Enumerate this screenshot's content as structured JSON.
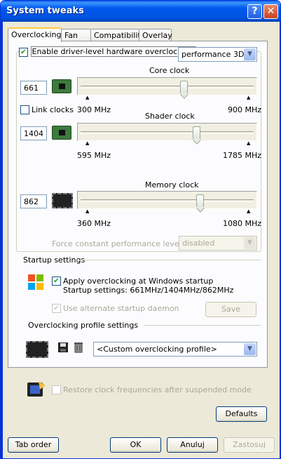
{
  "window": {
    "title": "System tweaks",
    "help_glyph": "?",
    "close_glyph": "✕"
  },
  "tabs": [
    {
      "label": "Overclocking"
    },
    {
      "label": "Fan"
    },
    {
      "label": "Compatibility"
    },
    {
      "label": "Overlay"
    }
  ],
  "overclock": {
    "enable_label": "Enable driver-level hardware overclocking",
    "enable_checked": true,
    "mode_value": "performance 3D",
    "link_clocks_label": "Link clocks",
    "link_clocks_checked": false,
    "core": {
      "title": "Core clock",
      "value": "661",
      "min": "300 MHz",
      "max": "900 MHz",
      "level": 0.6
    },
    "shader": {
      "title": "Shader clock",
      "value": "1404",
      "min": "595 MHz",
      "max": "1785 MHz",
      "level": 0.68
    },
    "memory": {
      "title": "Memory clock",
      "value": "862",
      "min": "360 MHz",
      "max": "1080 MHz",
      "level": 0.7
    },
    "force_label": "Force constant performance level",
    "force_value": "disabled"
  },
  "startup": {
    "section_label": "Startup settings",
    "apply_label": "Apply overclocking at Windows startup",
    "apply_checked": true,
    "settings_text": "Startup settings: 661MHz/1404MHz/862MHz",
    "alt_daemon_label": "Use alternate startup daemon",
    "save_label": "Save"
  },
  "profile": {
    "section_label": "Overclocking profile settings",
    "value": "<Custom overclocking profile>"
  },
  "restore_label": "Restore clock frequencies after suspended mode",
  "buttons": {
    "defaults": "Defaults",
    "tab_order": "Tab order",
    "ok": "OK",
    "cancel": "Anuluj",
    "apply": "Zastosuj"
  },
  "colors": {
    "title_bar": "#0058ee",
    "accent_tab": "#ffc83c",
    "check": "#21a121"
  }
}
